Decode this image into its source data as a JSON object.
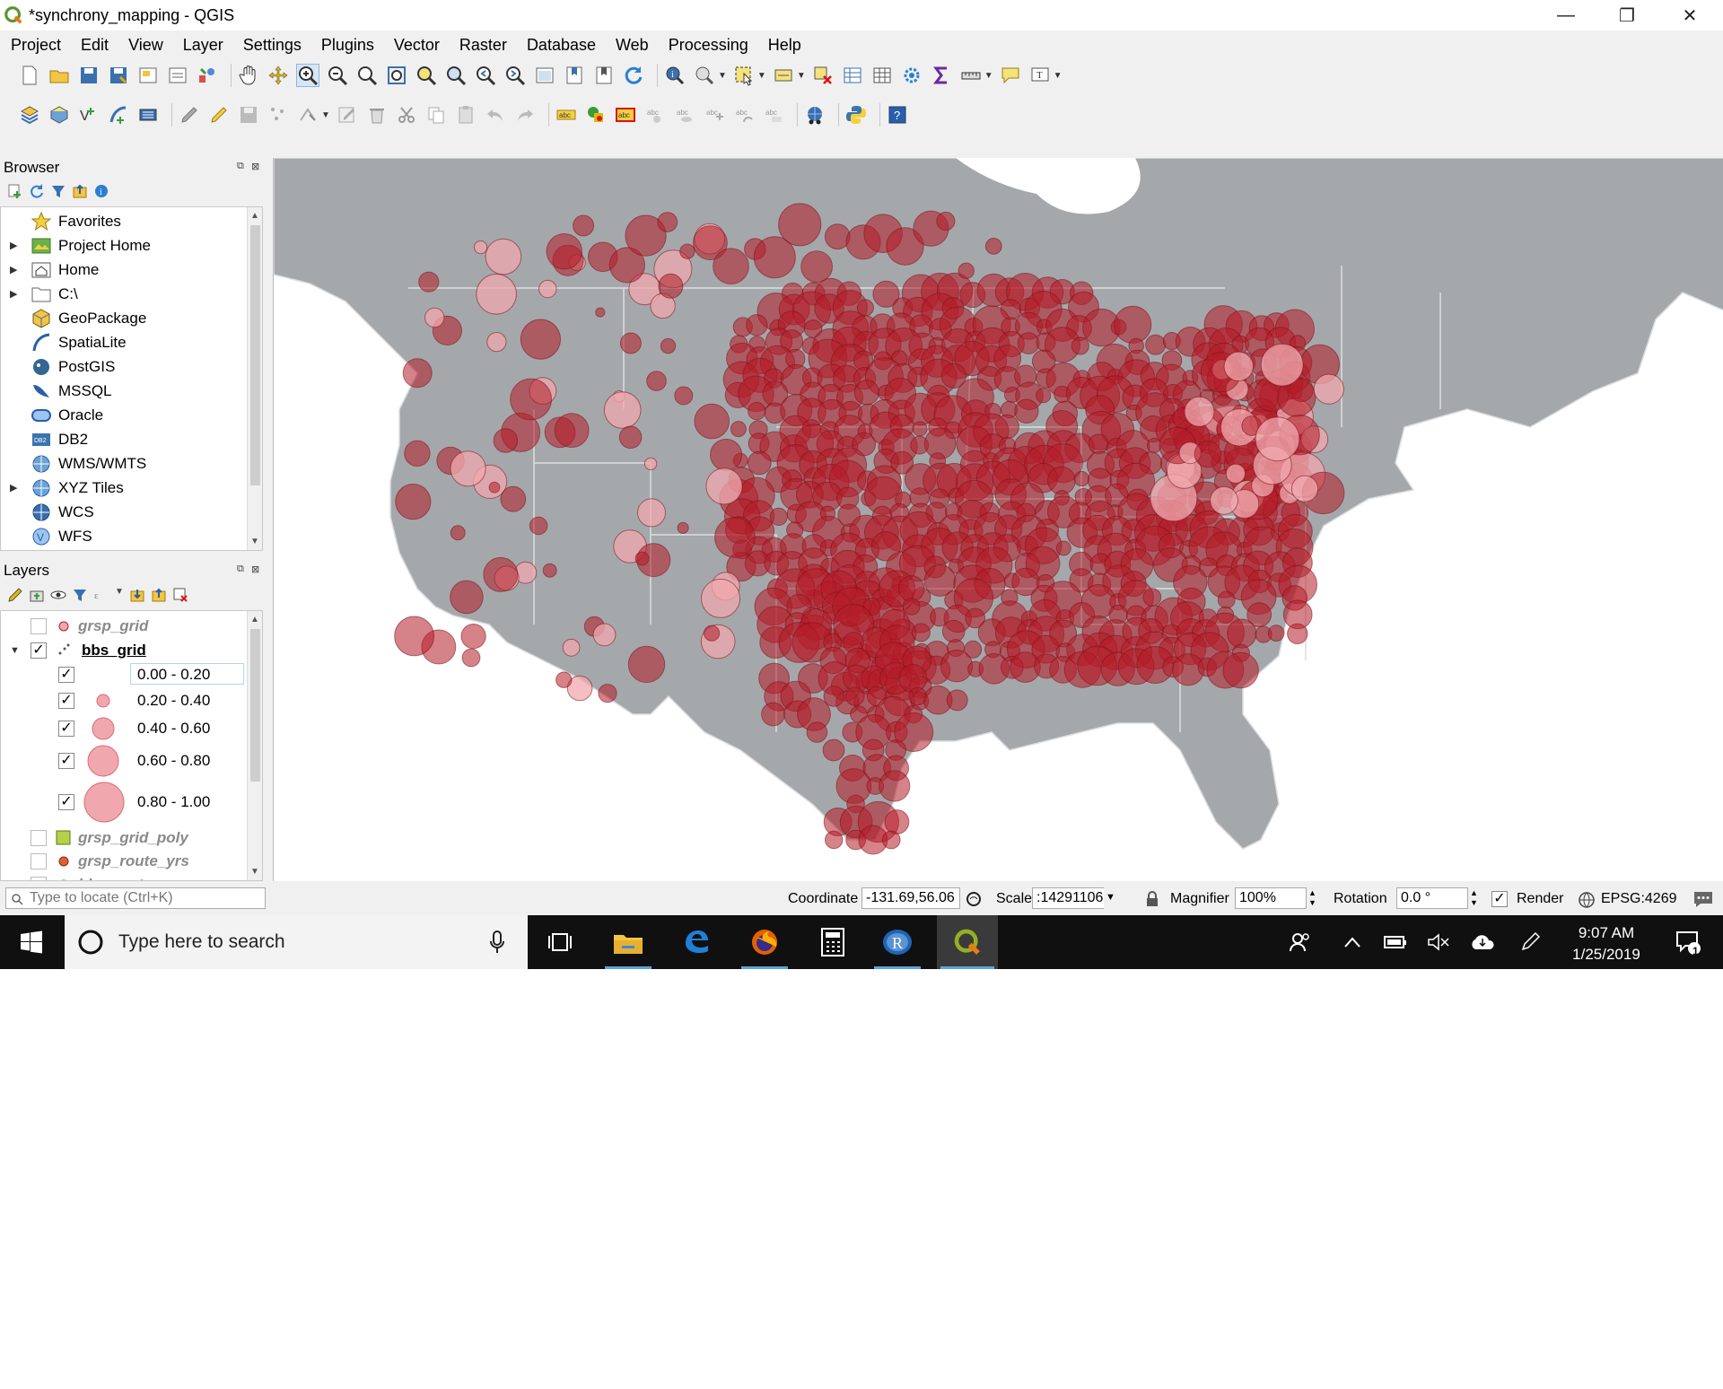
{
  "window": {
    "title": "*synchrony_mapping - QGIS",
    "controls": {
      "minimize": "—",
      "restore": "❐",
      "close": "✕"
    }
  },
  "menubar": [
    "Project",
    "Edit",
    "View",
    "Layer",
    "Settings",
    "Plugins",
    "Vector",
    "Raster",
    "Database",
    "Web",
    "Processing",
    "Help"
  ],
  "browser": {
    "title": "Browser",
    "items": [
      {
        "label": "Favorites",
        "icon": "star-icon",
        "expandable": false
      },
      {
        "label": "Project Home",
        "icon": "project-home-icon",
        "expandable": true
      },
      {
        "label": "Home",
        "icon": "home-icon",
        "expandable": true
      },
      {
        "label": "C:\\",
        "icon": "folder-icon",
        "expandable": true
      },
      {
        "label": "GeoPackage",
        "icon": "geopackage-icon",
        "expandable": false
      },
      {
        "label": "SpatiaLite",
        "icon": "spatialite-icon",
        "expandable": false
      },
      {
        "label": "PostGIS",
        "icon": "postgis-icon",
        "expandable": false
      },
      {
        "label": "MSSQL",
        "icon": "mssql-icon",
        "expandable": false
      },
      {
        "label": "Oracle",
        "icon": "oracle-icon",
        "expandable": false
      },
      {
        "label": "DB2",
        "icon": "db2-icon",
        "expandable": false
      },
      {
        "label": "WMS/WMTS",
        "icon": "wms-icon",
        "expandable": false
      },
      {
        "label": "XYZ Tiles",
        "icon": "xyz-icon",
        "expandable": true
      },
      {
        "label": "WCS",
        "icon": "wcs-icon",
        "expandable": false
      },
      {
        "label": "WFS",
        "icon": "wfs-icon",
        "expandable": false
      }
    ]
  },
  "layers": {
    "title": "Layers",
    "items": [
      {
        "name": "grsp_grid",
        "checked": false
      },
      {
        "name": "bbs_grid",
        "checked": true
      },
      {
        "name": "grsp_grid_poly",
        "checked": false
      },
      {
        "name": "grsp_route_yrs",
        "checked": false
      },
      {
        "name": "bbs_routes",
        "checked": false
      }
    ],
    "legend": [
      {
        "label": "0.00 - 0.20",
        "checked": true
      },
      {
        "label": "0.20 - 0.40",
        "checked": true
      },
      {
        "label": "0.40 - 0.60",
        "checked": true
      },
      {
        "label": "0.60 - 0.80",
        "checked": true
      },
      {
        "label": "0.80 - 1.00",
        "checked": true
      }
    ]
  },
  "map": {
    "land_color": "#a5a8ab",
    "water_color": "#ffffff",
    "boundary_color": "#dcdde0",
    "marker_fill": "#b51c28",
    "marker_stroke": "#7e1018",
    "light_marker_fill": "#f0a8ae"
  },
  "status": {
    "coordinate_label": "Coordinate",
    "coordinate": "-131.69,56.06",
    "scale_label": "Scale",
    "scale": ":14291106",
    "magnifier_label": "Magnifier",
    "magnifier": "100%",
    "rotation_label": "Rotation",
    "rotation": "0.0 °",
    "render_label": "Render",
    "render_checked": true,
    "crs": "EPSG:4269",
    "locate_placeholder": "Type to locate (Ctrl+K)"
  },
  "taskbar": {
    "search_placeholder": "Type here to search",
    "time": "9:07 AM",
    "date": "1/25/2019",
    "notification_count": "1"
  }
}
